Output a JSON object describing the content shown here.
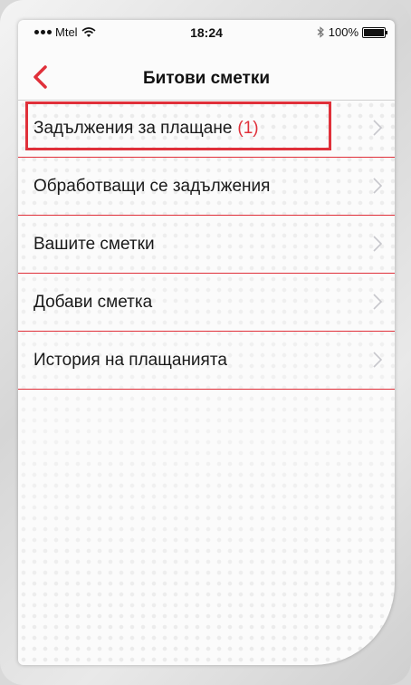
{
  "status_bar": {
    "carrier": "Mtel",
    "time": "18:24",
    "battery": "100%"
  },
  "nav": {
    "title": "Битови сметки"
  },
  "menu": {
    "items": [
      {
        "label": "Задължения за плащане",
        "count": "(1)"
      },
      {
        "label": "Обработващи се задължения"
      },
      {
        "label": "Вашите сметки"
      },
      {
        "label": "Добави сметка"
      },
      {
        "label": "История на плащанията"
      }
    ]
  },
  "colors": {
    "accent": "#e0303a",
    "text": "#1a1a1a",
    "chevron": "#c7c7cc"
  },
  "icons": [
    "back-arrow-icon",
    "wifi-icon",
    "bluetooth-icon",
    "battery-icon",
    "chevron-right-icon"
  ]
}
